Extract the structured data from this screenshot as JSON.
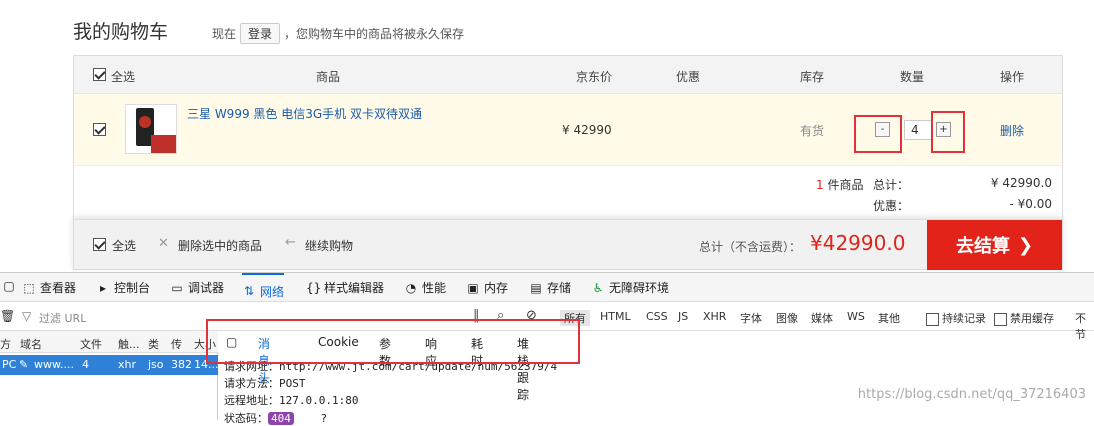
{
  "cart": {
    "title": "我的购物车",
    "now_label": "现在",
    "login_label": "登录",
    "login_note": "，您购物车中的商品将被永久保存"
  },
  "table": {
    "headers": {
      "select_all": "全选",
      "product": "商品",
      "price": "京东价",
      "promo": "优惠",
      "stock": "库存",
      "quantity": "数量",
      "action": "操作"
    },
    "item": {
      "name": "三星 W999 黑色 电信3G手机 双卡双待双通",
      "price": "¥ 42990",
      "stock": "有货",
      "minus": "-",
      "plus": "+",
      "quantity": "4",
      "delete": "删除"
    },
    "summary": {
      "count": "1",
      "count_suffix": "件商品",
      "total_label": "总计：",
      "total_value": "¥ 42990.0",
      "discount_label": "优惠：",
      "discount_value": "- ¥0.00"
    }
  },
  "footer": {
    "select_all": "全选",
    "delete_selected": "删除选中的商品",
    "continue": "继续购物",
    "total_label": "总计（不含运费）：",
    "total_value": "¥42990.0",
    "checkout": "去结算"
  },
  "devtools": {
    "tabs": [
      "查看器",
      "控制台",
      "调试器",
      "网络",
      "样式编辑器",
      "性能",
      "内存",
      "存储",
      "无障碍环境"
    ],
    "filter_placeholder": "过滤 URL",
    "types": [
      "所有",
      "HTML",
      "CSS",
      "JS",
      "XHR",
      "字体",
      "图像",
      "媒体",
      "WS",
      "其他"
    ],
    "persist": "持续记录",
    "disable_cache": "禁用缓存",
    "throttle": "不节",
    "list_headers": [
      "方",
      "域名",
      "文件",
      "触...",
      "类",
      "传",
      "大小"
    ],
    "row": {
      "method": "PC",
      "domain": "www....",
      "file": "4",
      "cause": "xhr",
      "type": "jso",
      "transfer": "382",
      "size": "14..."
    },
    "detail_tabs": [
      "消息头",
      "Cookie",
      "参数",
      "响应",
      "耗时",
      "堆栈跟踪"
    ],
    "request_url_label": "请求网址：",
    "request_url": "http://www.jt.com/cart/update/num/562379/4",
    "request_method_label": "请求方法：",
    "request_method": "POST",
    "remote_label": "远程地址：",
    "remote": "127.0.0.1:80",
    "status_label": "状态码：",
    "status": "404"
  },
  "watermark": "https://blog.csdn.net/qq_37216403",
  "colors": {
    "accent_red": "#e2231a",
    "link_blue": "#1a5aa7",
    "highlight_box": "#e0323a",
    "devtools_selected": "#2f81d8"
  }
}
